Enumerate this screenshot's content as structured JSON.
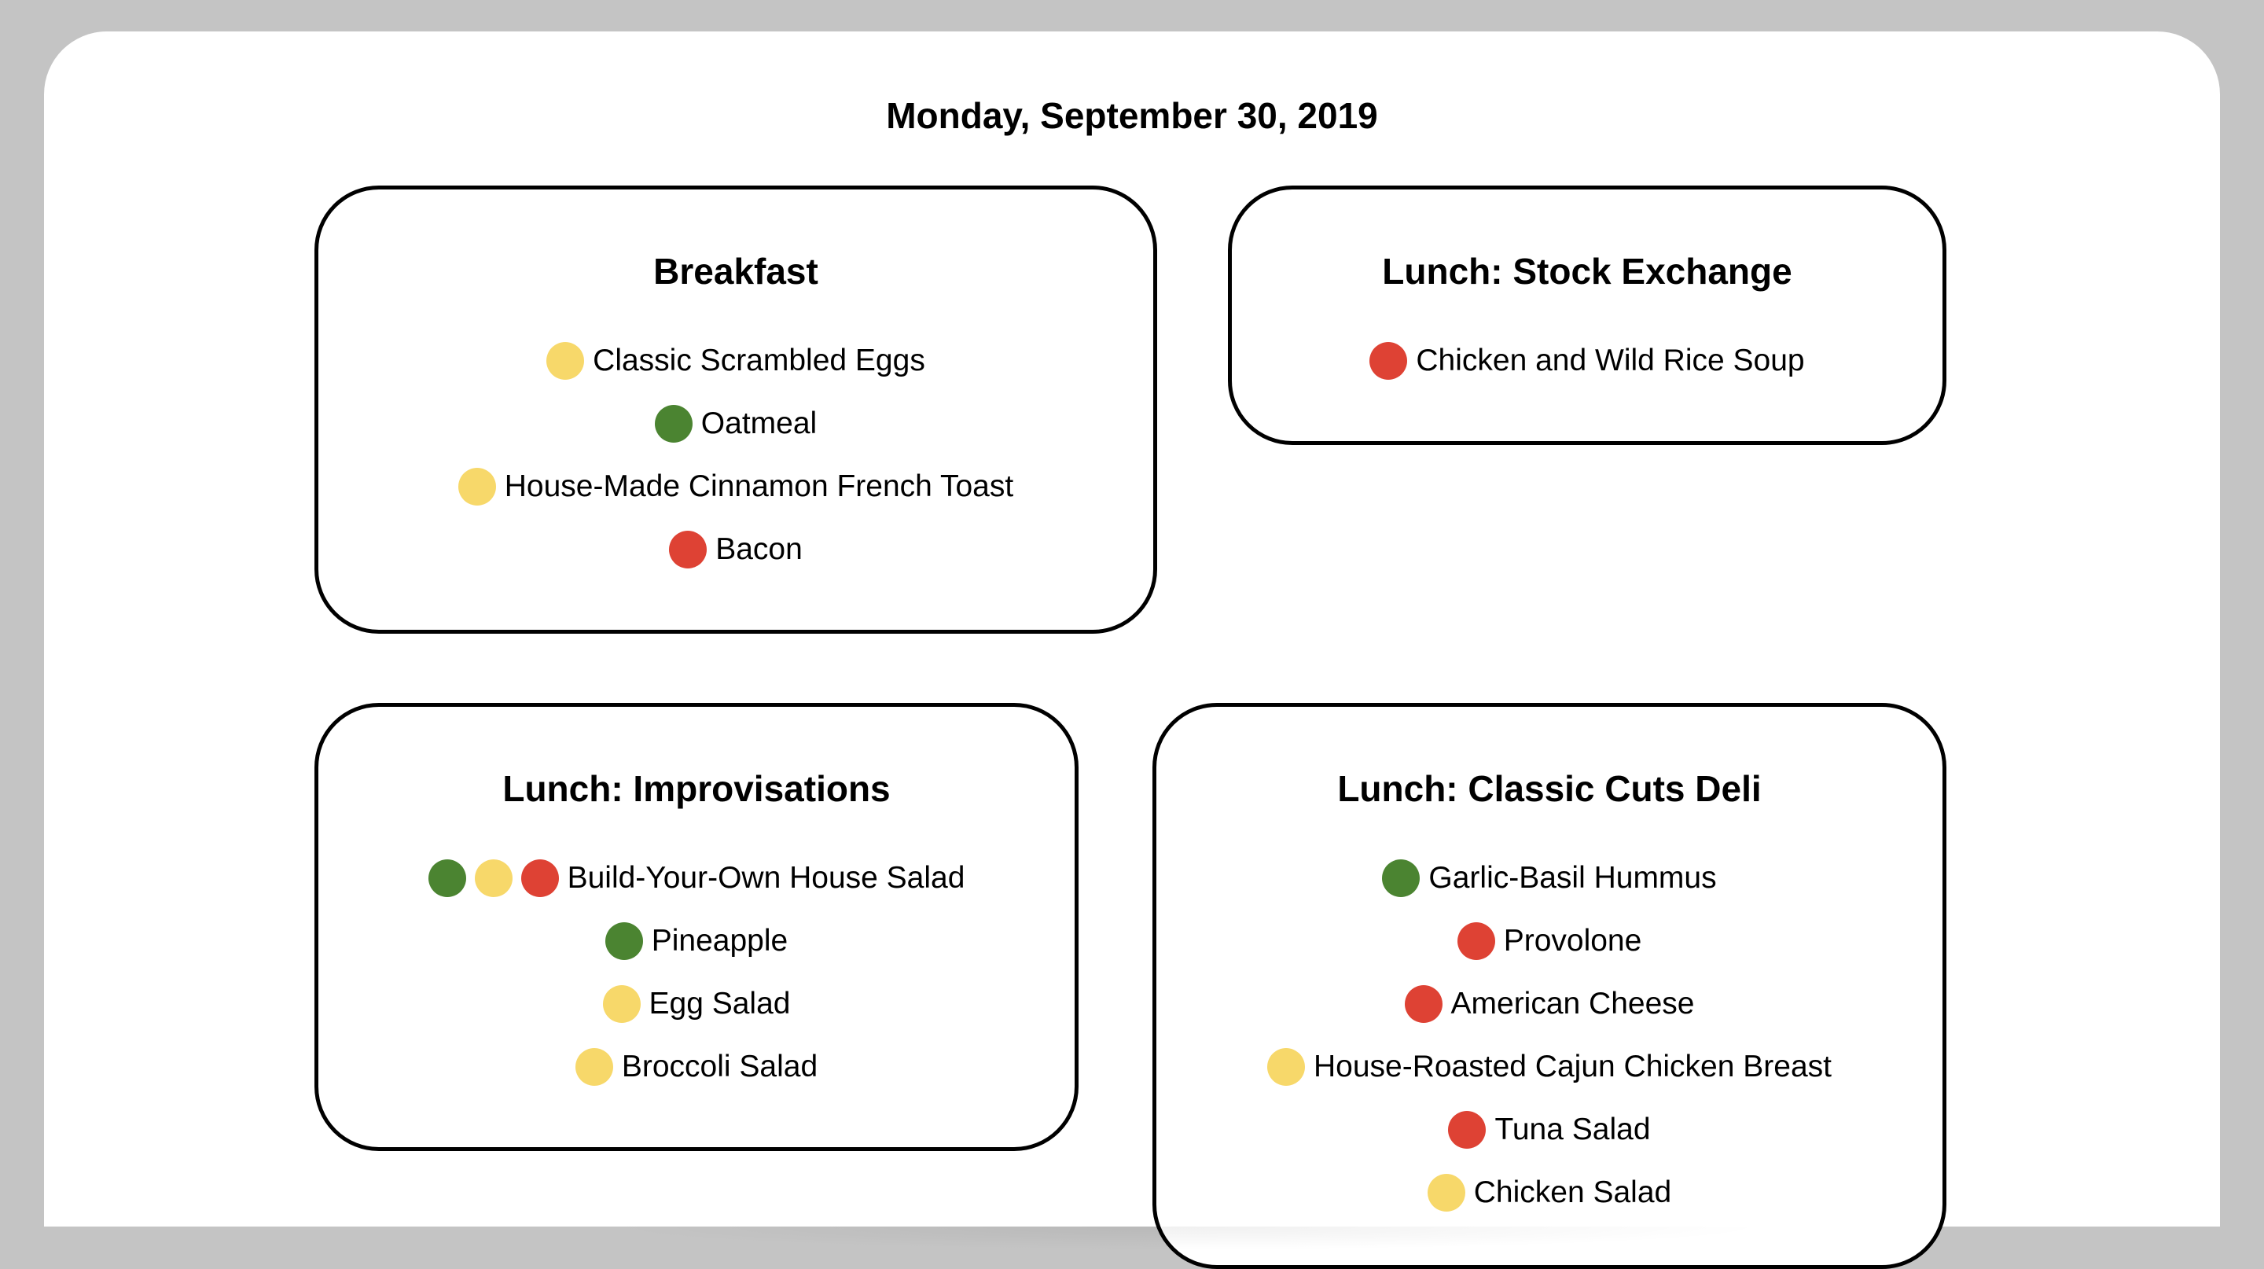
{
  "date": "Monday, September 30, 2019",
  "legend_colors": {
    "green": "#4b8431",
    "yellow": "#f7d86a",
    "red": "#de4234"
  },
  "cards": {
    "breakfast": {
      "title": "Breakfast",
      "items": [
        {
          "name": "Classic Scrambled Eggs",
          "dots": [
            "yellow"
          ]
        },
        {
          "name": "Oatmeal",
          "dots": [
            "green"
          ]
        },
        {
          "name": "House-Made Cinnamon French Toast",
          "dots": [
            "yellow"
          ]
        },
        {
          "name": "Bacon",
          "dots": [
            "red"
          ]
        }
      ]
    },
    "stock": {
      "title": "Lunch: Stock Exchange",
      "items": [
        {
          "name": "Chicken and Wild Rice Soup",
          "dots": [
            "red"
          ]
        }
      ]
    },
    "improv": {
      "title": "Lunch: Improvisations",
      "items": [
        {
          "name": "Build-Your-Own House Salad",
          "dots": [
            "green",
            "yellow",
            "red"
          ]
        },
        {
          "name": "Pineapple",
          "dots": [
            "green"
          ]
        },
        {
          "name": "Egg Salad",
          "dots": [
            "yellow"
          ]
        },
        {
          "name": "Broccoli Salad",
          "dots": [
            "yellow"
          ]
        }
      ]
    },
    "deli": {
      "title": "Lunch: Classic Cuts Deli",
      "items": [
        {
          "name": "Garlic-Basil Hummus",
          "dots": [
            "green"
          ]
        },
        {
          "name": "Provolone",
          "dots": [
            "red"
          ]
        },
        {
          "name": "American Cheese",
          "dots": [
            "red"
          ]
        },
        {
          "name": "House-Roasted Cajun Chicken Breast",
          "dots": [
            "yellow"
          ]
        },
        {
          "name": "Tuna Salad",
          "dots": [
            "red"
          ]
        },
        {
          "name": "Chicken Salad",
          "dots": [
            "yellow"
          ]
        }
      ]
    }
  }
}
